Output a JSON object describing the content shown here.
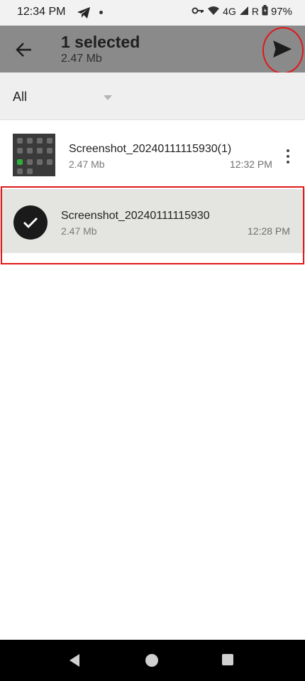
{
  "status_bar": {
    "time": "12:34 PM",
    "network": "4G",
    "roaming": "R",
    "battery": "97%"
  },
  "toolbar": {
    "title": "1 selected",
    "subtitle": "2.47 Mb"
  },
  "filter": {
    "selected": "All"
  },
  "files": [
    {
      "name": "Screenshot_20240111115930(1)",
      "size": "2.47 Mb",
      "time": "12:32 PM",
      "selected": false
    },
    {
      "name": "Screenshot_20240111115930",
      "size": "2.47 Mb",
      "time": "12:28 PM",
      "selected": true
    }
  ],
  "colors": {
    "toolbar_bg": "#8a8a8a",
    "selected_row_bg": "#e4e4e1",
    "highlight": "#e0191a"
  },
  "icons": {
    "back": "arrow-left-icon",
    "send": "send-icon",
    "more": "more-vert-icon",
    "check": "check-icon"
  }
}
